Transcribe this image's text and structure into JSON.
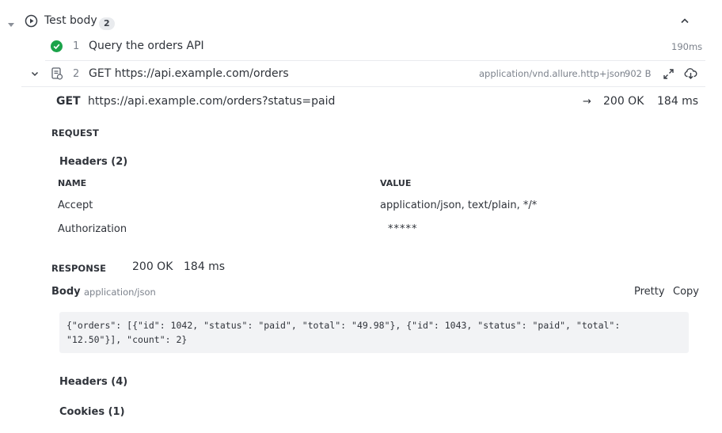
{
  "section": {
    "title": "Test body",
    "count": "2"
  },
  "steps": [
    {
      "number": "1",
      "title": "Query the orders API",
      "duration": "190ms",
      "status": "passed"
    },
    {
      "number": "2",
      "title": "GET https://api.example.com/orders",
      "mime": "application/vnd.allure.http+json",
      "size": "902 B"
    }
  ],
  "http": {
    "method": "GET",
    "url": "https://api.example.com/orders?status=paid",
    "arrow": "→",
    "status": "200 OK",
    "time": "184 ms",
    "request": {
      "label": "REQUEST",
      "headers_title": "Headers (2)",
      "col_name": "NAME",
      "col_value": "VALUE",
      "headers": [
        {
          "name": "Accept",
          "value": "application/json, text/plain, */*"
        },
        {
          "name": "Authorization",
          "value": "*****"
        }
      ]
    },
    "response": {
      "label": "RESPONSE",
      "status": "200 OK",
      "time": "184 ms",
      "body_label": "Body",
      "body_type": "application/json",
      "pretty": "Pretty",
      "copy": "Copy",
      "body": "{\"orders\": [{\"id\": 1042, \"status\": \"paid\", \"total\": \"49.98\"}, {\"id\": 1043, \"status\": \"paid\", \"total\": \"12.50\"}], \"count\": 2}",
      "headers_title": "Headers (4)",
      "cookies_title": "Cookies (1)"
    }
  },
  "colors": {
    "passed": "#1ba34a",
    "text": "#2f333a",
    "muted": "#7c828c",
    "code_bg": "#f2f3f5"
  },
  "icons": [
    "caret-down-icon",
    "play-circle-icon",
    "chevron-up-icon",
    "check-circle-icon",
    "chevron-down-icon",
    "http-attachment-icon",
    "expand-icon",
    "download-icon"
  ]
}
